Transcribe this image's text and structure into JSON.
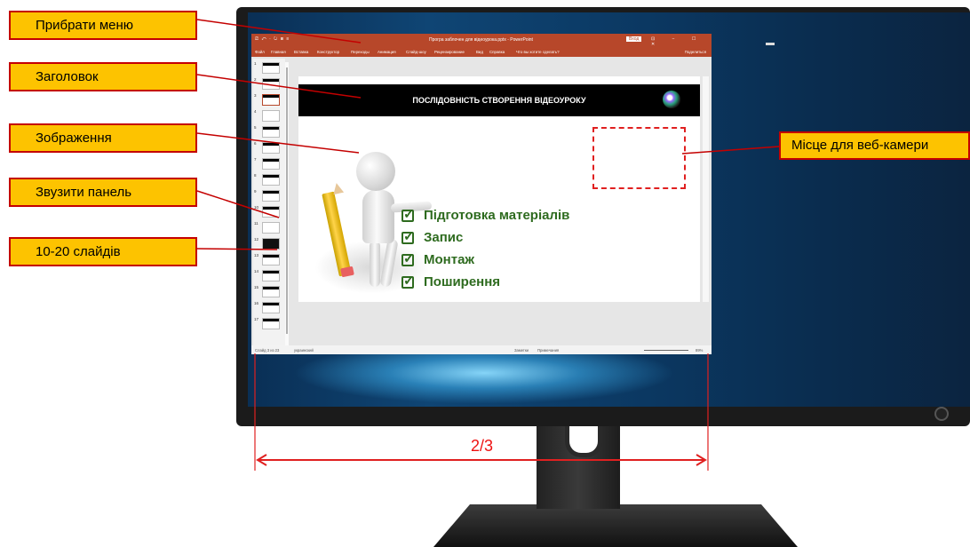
{
  "callouts": {
    "menu": "Прибрати меню",
    "header": "Заголовок",
    "image": "Зображення",
    "panel": "Звузити панель",
    "slides": "10-20 слайдів",
    "webcam": "Місце для веб-камери"
  },
  "measure": {
    "label": "2/3"
  },
  "ppt": {
    "title_text": "Програ заблочен для відеоурока.pptx - PowerPoint",
    "qat": "⎚ ↶ · ↻ ⊞ ≡",
    "sign_in": "Вход",
    "window_buttons": "⊡ − ☐ ✕",
    "ribbon_tabs": [
      "Файл",
      "Главная",
      "Вставка",
      "Конструктор",
      "Переходы",
      "Анимация",
      "Слайд-шоу",
      "Рецензирование",
      "Вид",
      "Справка",
      "Что вы хотите сделать?"
    ],
    "share": "Поделиться",
    "thumbnails": [
      "1",
      "2",
      "3",
      "4",
      "5",
      "6",
      "7",
      "8",
      "9",
      "10",
      "11",
      "12",
      "13",
      "14",
      "15",
      "16",
      "17"
    ],
    "status": {
      "slide_count": "Слайд 3 из 23",
      "language": "украинский",
      "notes": "Заметки",
      "comments": "Примечания",
      "zoom": "89%"
    }
  },
  "slide": {
    "title": "ПОСЛІДОВНІСТЬ СТВОРЕННЯ ВІДЕОУРОКУ",
    "items": [
      "Підготовка матеріалів",
      "Запис",
      "Монтаж",
      "Поширення"
    ],
    "check_glyph": "✓"
  },
  "colors": {
    "callout_fill": "#fdc300",
    "callout_border": "#c40000",
    "arrow_red": "#e02020",
    "ppt_ribbon": "#b7472a",
    "slide_text_green": "#2e6b1f",
    "monitor_bezel": "#1b1b1b"
  }
}
